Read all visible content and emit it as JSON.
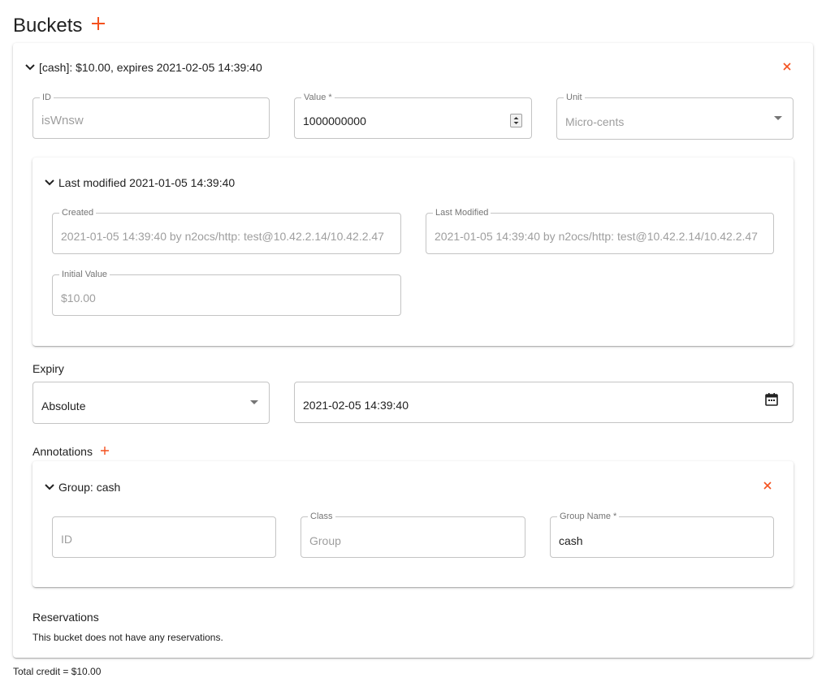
{
  "header": {
    "title": "Buckets"
  },
  "bucket": {
    "summary": "[cash]: $10.00, expires 2021-02-05 14:39:40",
    "fields": {
      "id": {
        "label": "ID",
        "value": "isWnsw"
      },
      "value": {
        "label": "Value *",
        "value": "1000000000"
      },
      "unit": {
        "label": "Unit",
        "value": "Micro-cents"
      }
    },
    "modified": {
      "summary": "Last modified 2021-01-05 14:39:40",
      "created": {
        "label": "Created",
        "value": "2021-01-05 14:39:40 by n2ocs/http: test@10.42.2.14/10.42.2.47"
      },
      "last_modified": {
        "label": "Last Modified",
        "value": "2021-01-05 14:39:40 by n2ocs/http: test@10.42.2.14/10.42.2.47"
      },
      "initial_value": {
        "label": "Initial Value",
        "value": "$10.00"
      }
    },
    "expiry": {
      "heading": "Expiry",
      "type": "Absolute",
      "date": "2021-02-05 14:39:40"
    },
    "annotations": {
      "heading": "Annotations",
      "group": {
        "summary": "Group: cash",
        "id": {
          "placeholder": "ID"
        },
        "class": {
          "label": "Class",
          "value": "Group"
        },
        "group_name": {
          "label": "Group Name *",
          "value": "cash"
        }
      }
    },
    "reservations": {
      "heading": "Reservations",
      "note": "This bucket does not have any reservations."
    }
  },
  "footer": {
    "total": "Total credit = $10.00"
  },
  "colors": {
    "accent": "#f4511e",
    "text": "#212121",
    "muted": "#9e9e9e",
    "border": "#c4c4c4"
  },
  "icons": [
    "add-icon",
    "chevron-down-icon",
    "close-icon",
    "calendar-icon",
    "spinner-arrows-icon",
    "dropdown-arrow-icon"
  ]
}
